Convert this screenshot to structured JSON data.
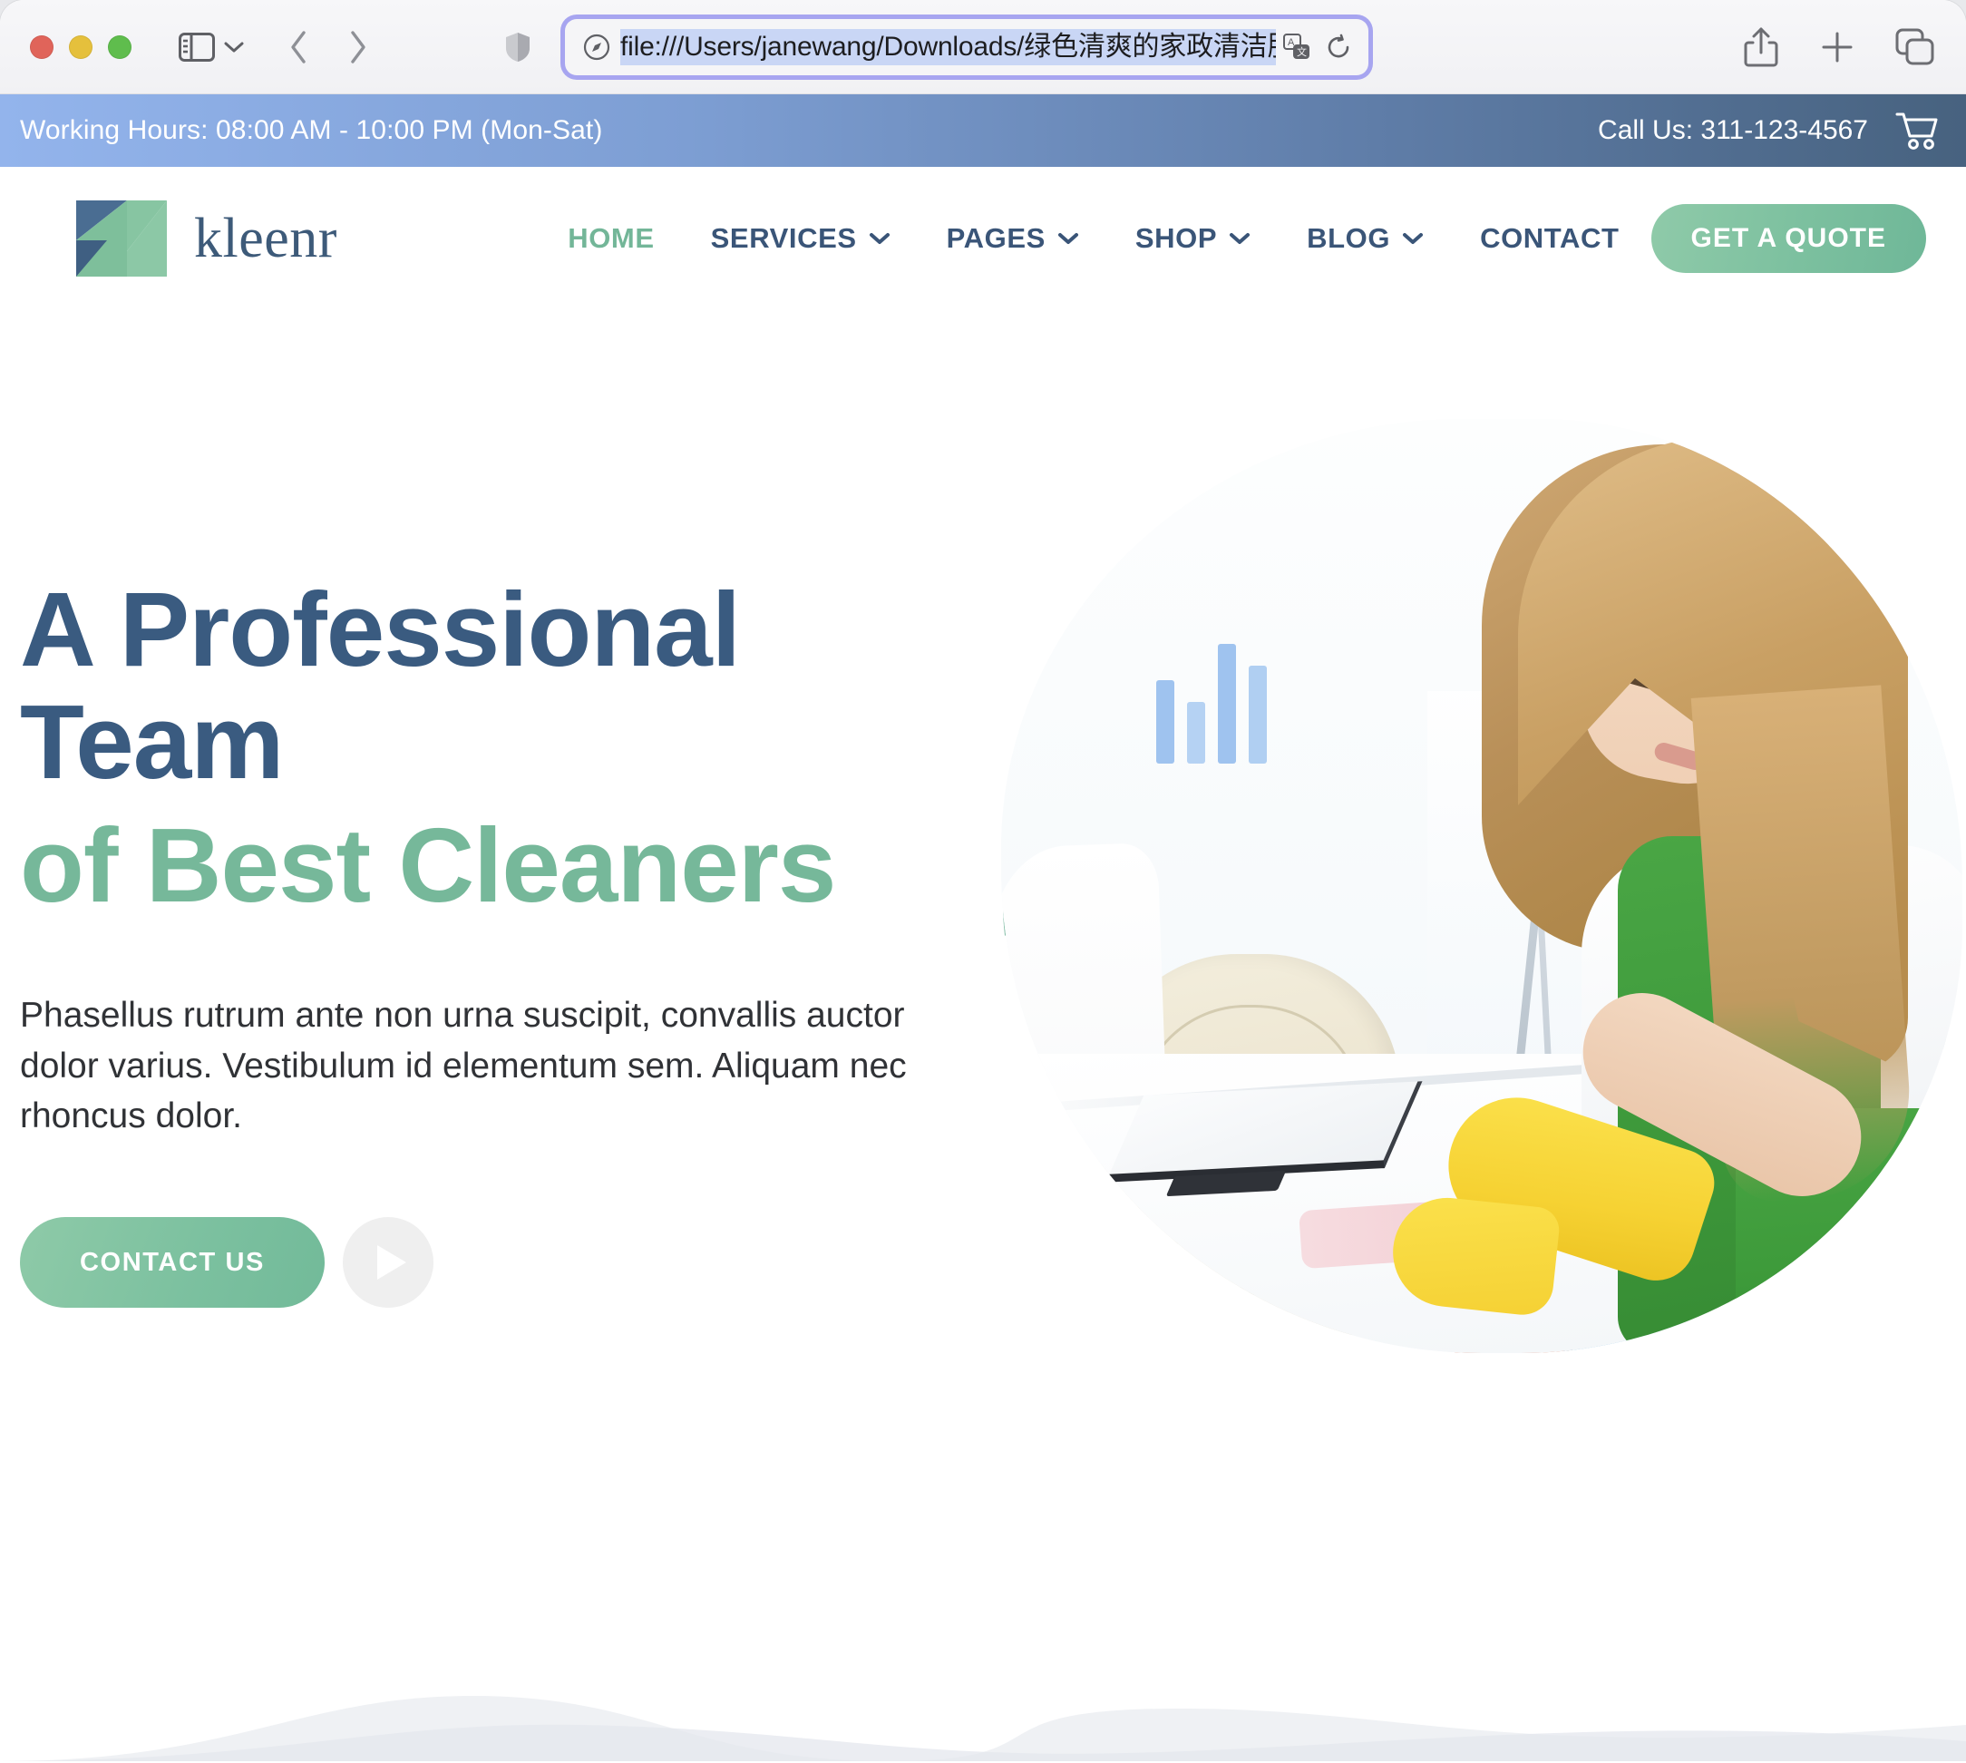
{
  "browser": {
    "url": "file:///Users/janewang/Downloads/绿色清爽的家政清洁服务公",
    "traffic_lights": [
      "close",
      "minimize",
      "zoom"
    ],
    "icons": {
      "sidebar": "sidebar-icon",
      "chevron_down": "chevron-down-icon",
      "back": "back-arrow-icon",
      "forward": "forward-arrow-icon",
      "shield": "shield-icon",
      "compass": "compass-icon",
      "translate": "translate-icon",
      "reload": "reload-icon",
      "share": "share-icon",
      "new_tab": "plus-icon",
      "tab_overview": "tab-overview-icon"
    }
  },
  "topbar": {
    "working_hours": "Working Hours: 08:00 AM - 10:00 PM (Mon-Sat)",
    "call_us": "Call Us: 311-123-4567",
    "cart_icon": "cart-icon"
  },
  "header": {
    "logo_text": "kleenr",
    "logo_mark": "kleenr-logo-mark",
    "nav": [
      {
        "label": "HOME",
        "has_caret": false,
        "active": true
      },
      {
        "label": "SERVICES",
        "has_caret": true,
        "active": false
      },
      {
        "label": "PAGES",
        "has_caret": true,
        "active": false
      },
      {
        "label": "SHOP",
        "has_caret": true,
        "active": false
      },
      {
        "label": "BLOG",
        "has_caret": true,
        "active": false
      },
      {
        "label": "CONTACT",
        "has_caret": false,
        "active": false
      }
    ],
    "quote_button": "GET A QUOTE"
  },
  "hero": {
    "heading_line1": "A Professional",
    "heading_line2": "Team",
    "heading_accent": "of Best Cleaners",
    "paragraph": "Phasellus rutrum ante non urna suscipit, convallis auctor dolor varius. Vestibulum id elementum sem. Aliquam nec rhoncus dolor.",
    "contact_button": "CONTACT US",
    "play_button": "play-video-button",
    "image_alt": "woman-in-green-apron-cleaning-office-desk"
  },
  "colors": {
    "brand_green": "#76b89a",
    "brand_navy": "#3a5b80",
    "button_green": "#7cc09f",
    "topbar_gradient_start": "#93b4ec",
    "topbar_gradient_end": "#47627f",
    "arc_green": "#8cc2ad",
    "play_button_blue": "#5b789f"
  }
}
